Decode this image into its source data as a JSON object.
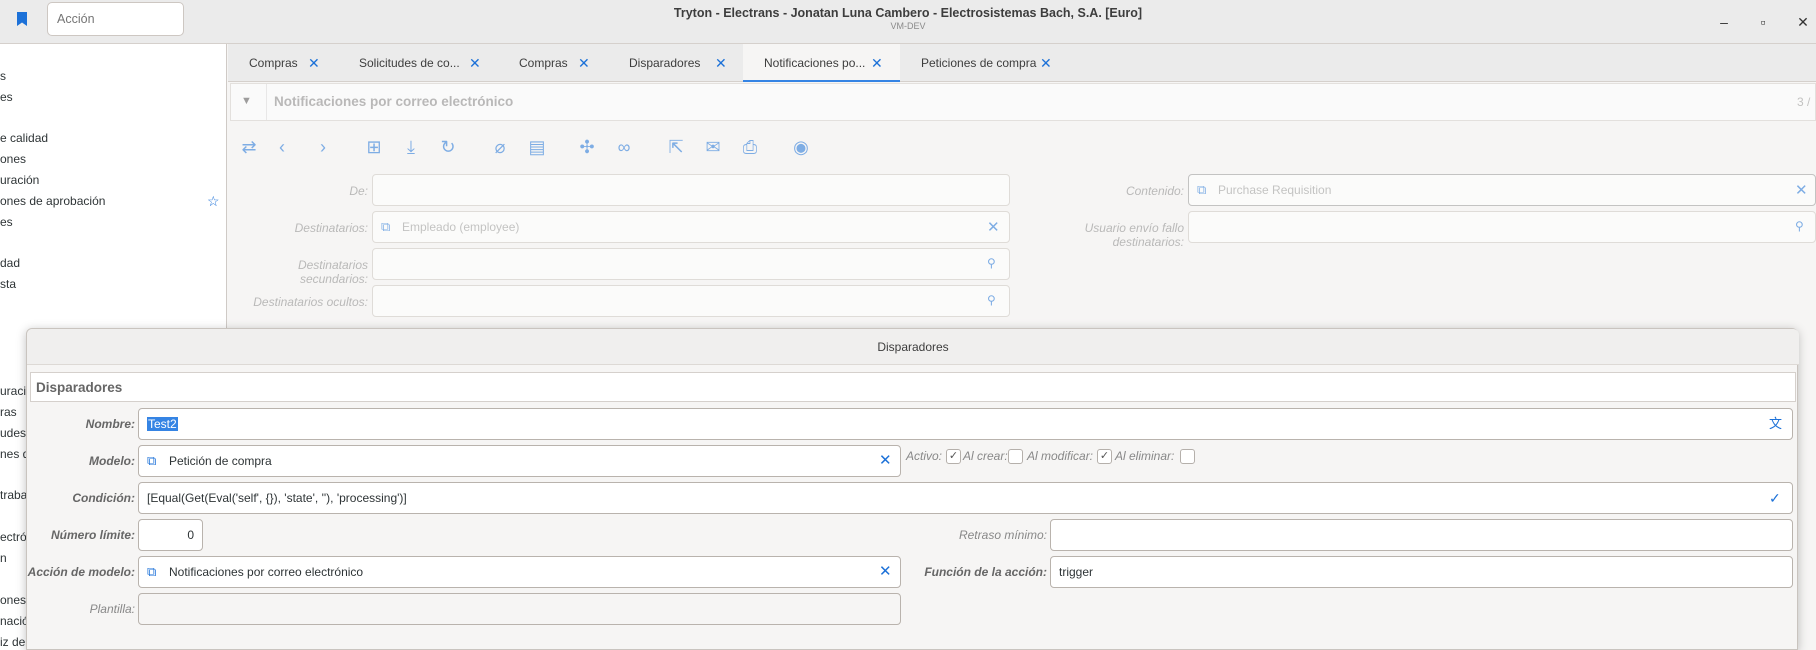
{
  "titlebar": {
    "action_placeholder": "Acción",
    "title": "Tryton - Electrans - Jonatan Luna Cambero - Electrosistemas Bach, S.A. [Euro]",
    "subtitle": "VM-DEV",
    "minimize": "–",
    "maximize": "▫",
    "close": "✕"
  },
  "sidebar": {
    "items": [
      "s",
      "es",
      "e calidad",
      "ones",
      "uración",
      "ones de aprobación",
      "es",
      "dad",
      "sta",
      "uraci",
      "ras",
      "udes d",
      "nes d",
      "traba",
      "ectró",
      "n",
      "ones",
      "nación",
      "iz de u"
    ]
  },
  "tabs": [
    {
      "label": "Compras"
    },
    {
      "label": "Solicitudes de co..."
    },
    {
      "label": "Compras"
    },
    {
      "label": "Disparadores"
    },
    {
      "label": "Notificaciones po..."
    },
    {
      "label": "Peticiones de compra"
    }
  ],
  "form": {
    "header": "Notificaciones por correo electrónico",
    "counter": "3 /",
    "labels": {
      "de": "De:",
      "destinatarios": "Destinatarios:",
      "secundarios": "Destinatarios secundarios:",
      "ocultos": "Destinatarios ocultos:",
      "contenido": "Contenido:",
      "usuario_fallo": "Usuario envío fallo destinatarios:"
    },
    "destinatarios_value": "Empleado (employee)",
    "contenido_value": "Purchase Requisition"
  },
  "dialog": {
    "title": "Disparadores",
    "section": "Disparadores",
    "labels": {
      "nombre": "Nombre:",
      "modelo": "Modelo:",
      "condicion": "Condición:",
      "numero_limite": "Número límite:",
      "accion_modelo": "Acción de modelo:",
      "plantilla": "Plantilla:",
      "activo": "Activo:",
      "al_crear": "Al crear:",
      "al_modificar": "Al modificar:",
      "al_eliminar": "Al eliminar:",
      "retraso": "Retraso mínimo:",
      "funcion": "Función de la acción:"
    },
    "nombre": "Test2",
    "modelo": "Petición de compra",
    "condicion": "[Equal(Get(Eval('self', {}), 'state', ''), 'processing')]",
    "numero_limite": "0",
    "accion_modelo": "Notificaciones por correo electrónico",
    "funcion": "trigger",
    "activo": true,
    "al_crear": false,
    "al_modificar": true,
    "al_eliminar": false
  }
}
